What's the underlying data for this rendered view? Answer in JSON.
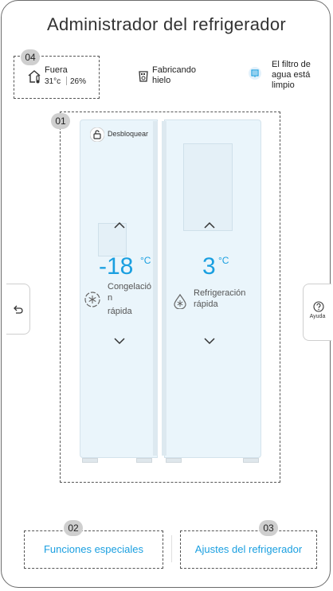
{
  "header": {
    "title": "Administrador del refrigerador"
  },
  "badges": {
    "b04": "04",
    "b01": "01",
    "b02": "02",
    "b03": "03"
  },
  "status": {
    "outside": {
      "label": "Fuera",
      "temp": "31°c",
      "humidity": "26%",
      "icon": "house-thermometer-icon"
    },
    "ice": {
      "line1": "Fabricando",
      "line2": "hielo",
      "icon": "ice-maker-icon"
    },
    "filter": {
      "line1": "El filtro de",
      "line2": "agua está",
      "line3": "limpio",
      "icon": "water-filter-icon"
    }
  },
  "fridge": {
    "unlock_label": "Desbloquear",
    "unlock_icon": "lock-open-icon",
    "freezer": {
      "temp": "-18",
      "unit": "°C",
      "label_line1": "Congelació",
      "label_line2": "n",
      "label_line3": "rápida",
      "icon": "snowflake-icon"
    },
    "refrigerator": {
      "temp": "3",
      "unit": "°C",
      "label_line1": "Refrigeración",
      "label_line2": "rápida",
      "icon": "drop-snowflake-icon"
    }
  },
  "side": {
    "back_icon": "back-arrow-icon",
    "help_icon": "help-icon",
    "help_label": "Ayuda"
  },
  "bottom": {
    "special_functions": "Funciones especiales",
    "fridge_settings": "Ajustes del refrigerador"
  },
  "colors": {
    "accent": "#1a9fe0",
    "door": "#eaf5fb"
  }
}
